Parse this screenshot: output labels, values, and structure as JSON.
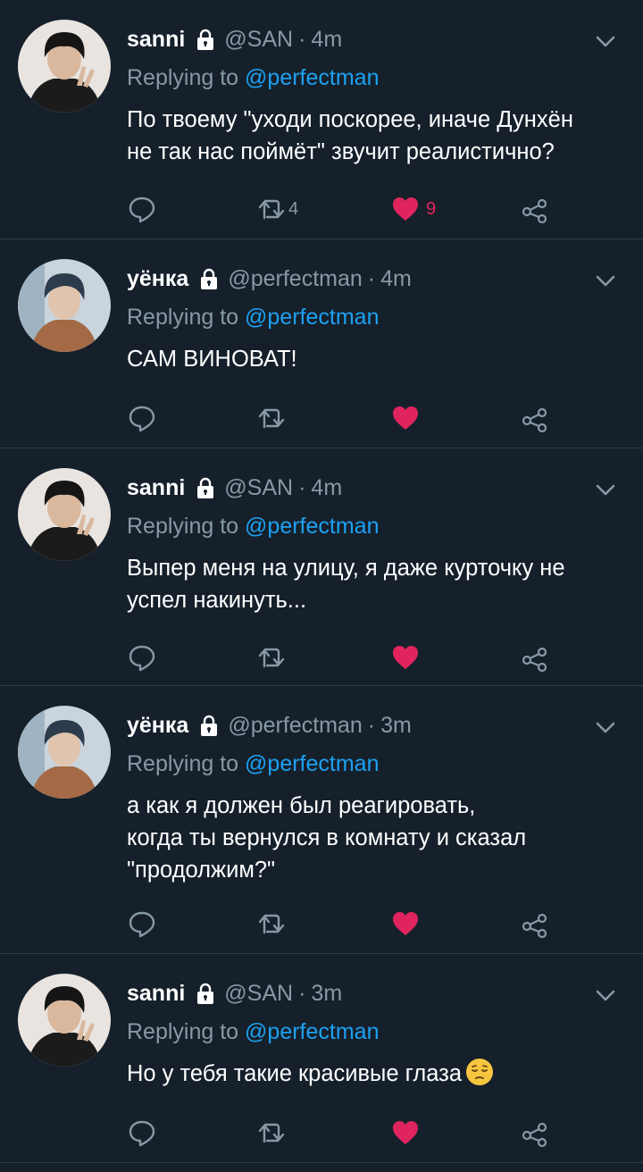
{
  "tweets": [
    {
      "name": "sanni",
      "handle": "@SAN",
      "dot": "·",
      "time": "4m",
      "reply_prefix": "Replying to",
      "reply_to": "@perfectman",
      "text_lines": [
        "По твоему \"уходи поскорее, иначе Дунхён",
        "не так нас поймёт\" звучит реалистично?"
      ],
      "retweets": "4",
      "likes": "9"
    },
    {
      "name": "уёнка",
      "handle": "@perfectman",
      "dot": "·",
      "time": "4m",
      "reply_prefix": "Replying to",
      "reply_to": "@perfectman",
      "text_lines": [
        "САМ ВИНОВАТ!"
      ],
      "retweets": "",
      "likes": ""
    },
    {
      "name": "sanni",
      "handle": "@SAN",
      "dot": "·",
      "time": "4m",
      "reply_prefix": "Replying to",
      "reply_to": "@perfectman",
      "text_lines": [
        "Выпер меня на улицу, я даже курточку не",
        "успел накинуть..."
      ],
      "retweets": "",
      "likes": ""
    },
    {
      "name": "уёнка",
      "handle": "@perfectman",
      "dot": "·",
      "time": "3m",
      "reply_prefix": "Replying to",
      "reply_to": "@perfectman",
      "text_lines": [
        "а как я должен был реагировать,",
        "когда ты вернулся в комнату и сказал",
        "\"продолжим?\""
      ],
      "retweets": "",
      "likes": ""
    },
    {
      "name": "sanni",
      "handle": "@SAN",
      "dot": "·",
      "time": "3m",
      "reply_prefix": "Replying to",
      "reply_to": "@perfectman",
      "text_lines": [
        "Но у тебя такие красивые глаза"
      ],
      "retweets": "",
      "likes": ""
    }
  ],
  "colors": {
    "background": "#15202b",
    "divider": "#2f3b47",
    "secondary_text": "#8899a6",
    "mention": "#1da1f2",
    "like": "#e0245e"
  },
  "icons": [
    "lock-icon",
    "chevron-down-icon",
    "reply-icon",
    "retweet-icon",
    "heart-icon",
    "share-icon",
    "pensive-face-emoji"
  ]
}
